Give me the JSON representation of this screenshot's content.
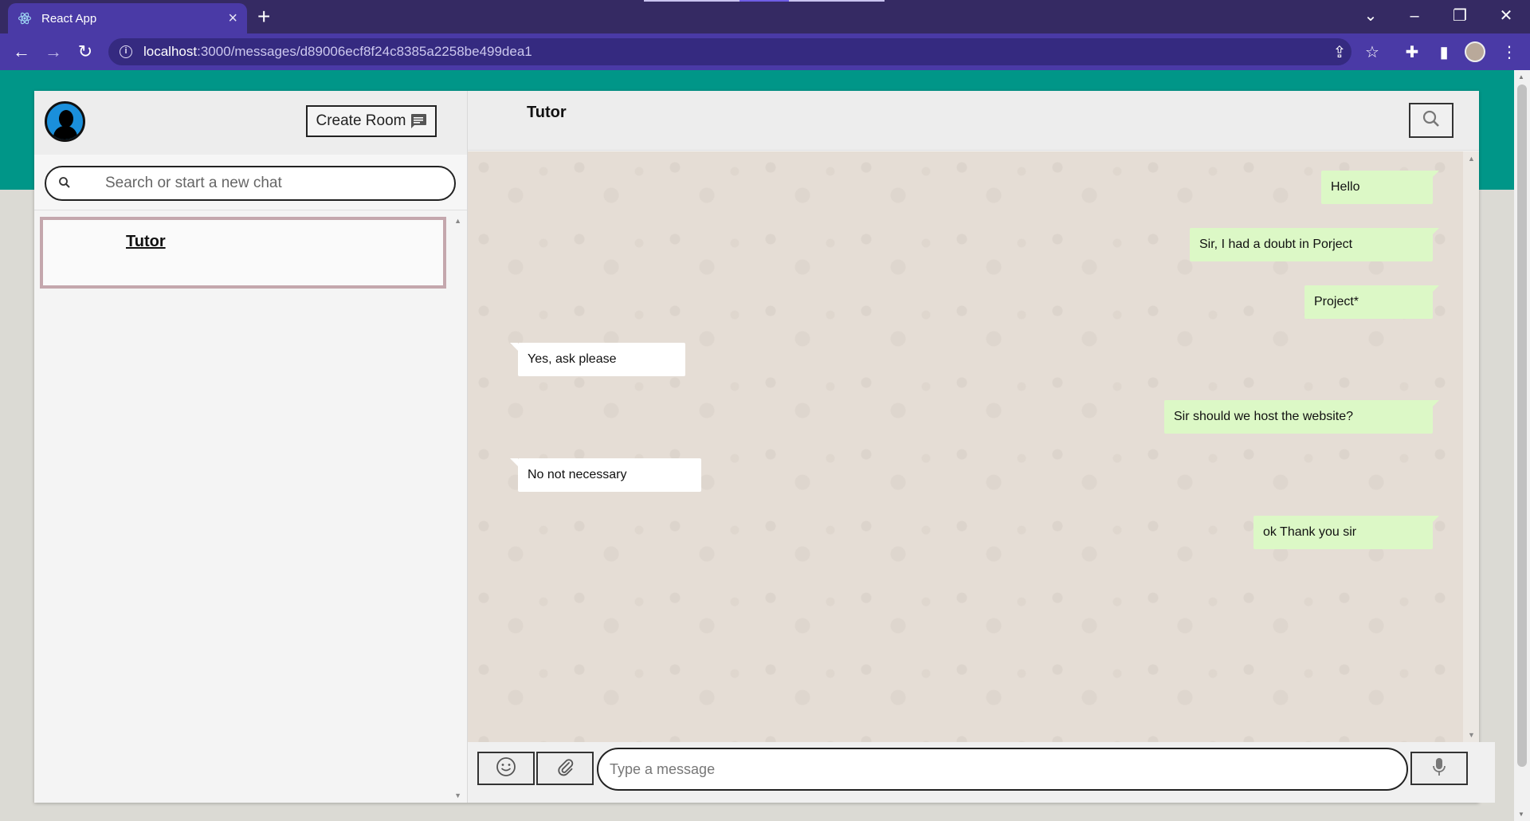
{
  "browser": {
    "tab_title": "React App",
    "url_host": "localhost",
    "url_rest": ":3000/messages/d89006ecf8f24c8385a2258be499dea1"
  },
  "sidebar": {
    "create_room_label": "Create Room",
    "search_placeholder": "Search or start a new chat",
    "chats": [
      {
        "name": "Tutor"
      }
    ]
  },
  "chat": {
    "title": "Tutor",
    "input_placeholder": "Type a message",
    "messages": [
      {
        "text": "Hello",
        "direction": "sent"
      },
      {
        "text": "Sir, I had a doubt in Porject",
        "direction": "sent"
      },
      {
        "text": "Project*",
        "direction": "sent"
      },
      {
        "text": "Yes, ask please",
        "direction": "received"
      },
      {
        "text": "Sir should we host the website?",
        "direction": "sent"
      },
      {
        "text": "No not necessary",
        "direction": "received"
      },
      {
        "text": "ok Thank you sir",
        "direction": "sent"
      }
    ]
  },
  "colors": {
    "browser_frame": "#352a63",
    "toolbar": "#4a3aa6",
    "app_header_band": "#009688",
    "sent_bubble": "#dcf8c6",
    "received_bubble": "#ffffff",
    "chat_background": "#e5ddd5"
  },
  "icons": {
    "tab_favicon": "react-icon",
    "create_room": "chat-icon",
    "sidebar_search": "search-icon",
    "chat_search": "search-icon",
    "emoji": "emoji-icon",
    "attach": "paperclip-icon",
    "mic": "mic-icon"
  }
}
